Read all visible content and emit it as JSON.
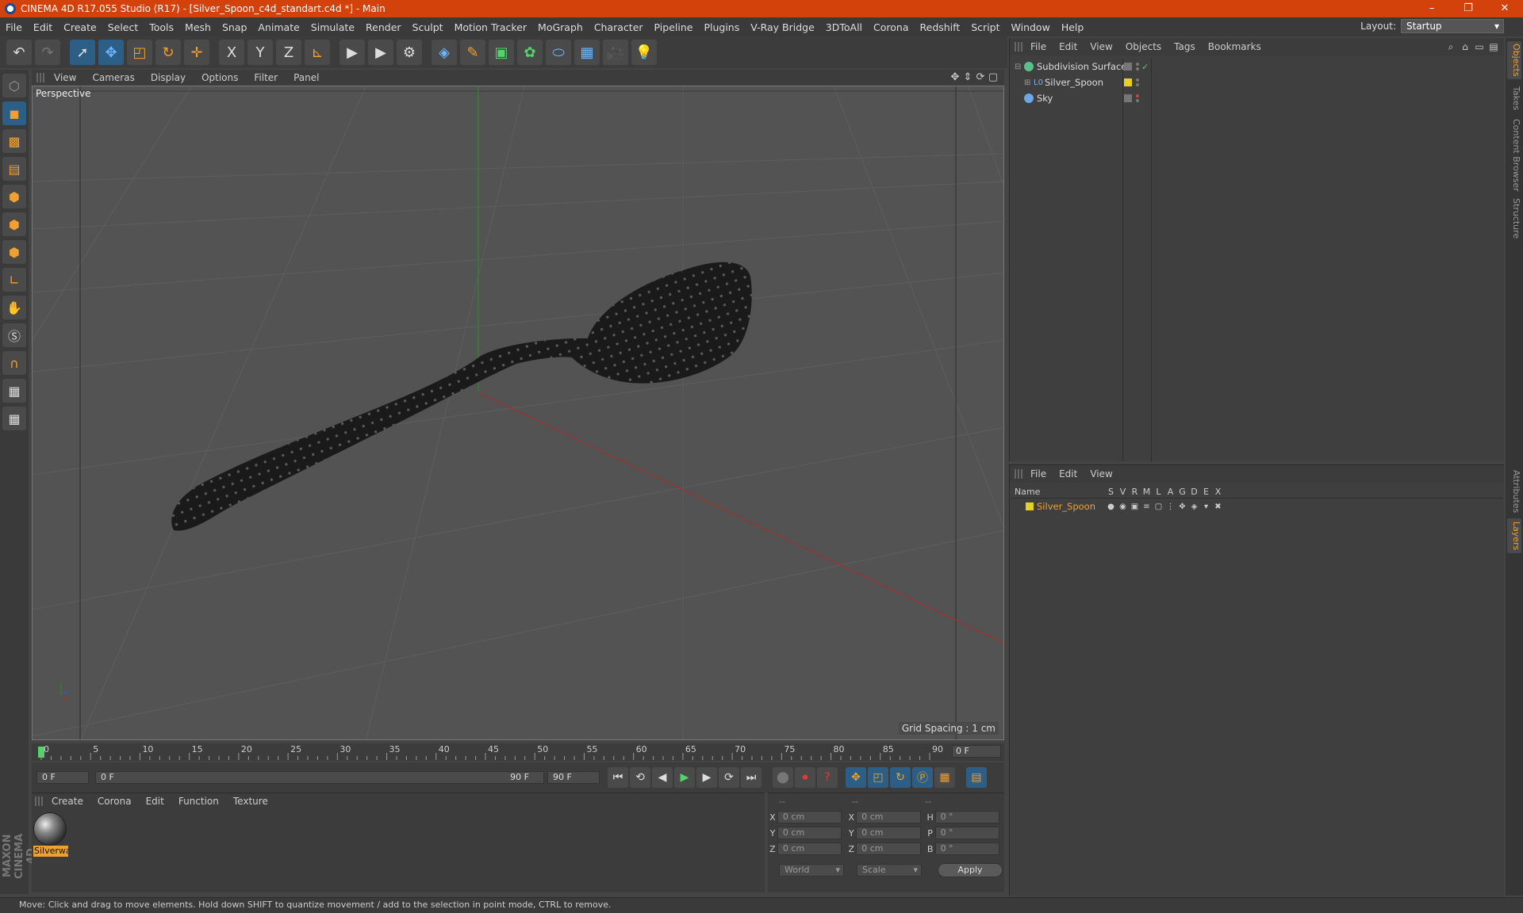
{
  "window": {
    "title": "CINEMA 4D R17.055 Studio (R17) - [Silver_Spoon_c4d_standart.c4d *] - Main",
    "controls": [
      "–",
      "❐",
      "✕"
    ]
  },
  "menubar": {
    "items": [
      "File",
      "Edit",
      "Create",
      "Select",
      "Tools",
      "Mesh",
      "Snap",
      "Animate",
      "Simulate",
      "Render",
      "Sculpt",
      "Motion Tracker",
      "MoGraph",
      "Character",
      "Pipeline",
      "Plugins",
      "V-Ray Bridge",
      "3DToAll",
      "Corona",
      "Redshift",
      "Script",
      "Window",
      "Help"
    ],
    "layout_label": "Layout:",
    "layout_value": "Startup"
  },
  "toolbar": {
    "icons": [
      "undo-icon",
      "redo-icon",
      "select-arrow-icon",
      "move-icon",
      "scale-icon",
      "rotate-icon",
      "add-tool-icon",
      "x-axis-icon",
      "y-axis-icon",
      "z-axis-icon",
      "coordinate-system-icon",
      "render-view-icon",
      "render-picture-viewer-icon",
      "edit-render-settings-icon",
      "cube-icon",
      "pen-icon",
      "subdivision-icon",
      "array-icon",
      "deformer-icon",
      "floor-icon",
      "camera-icon",
      "light-icon"
    ],
    "axis_labels": [
      "X",
      "Y",
      "Z"
    ]
  },
  "viewport": {
    "menu": [
      "View",
      "Cameras",
      "Display",
      "Options",
      "Filter",
      "Panel"
    ],
    "label": "Perspective",
    "grid_spacing": "Grid Spacing : 1 cm"
  },
  "timeline": {
    "ticks": [
      "0",
      "5",
      "10",
      "15",
      "20",
      "25",
      "30",
      "35",
      "40",
      "45",
      "50",
      "55",
      "60",
      "65",
      "70",
      "75",
      "80",
      "85",
      "90"
    ],
    "current_frame": "0 F",
    "start_field": "0 F",
    "range_start": "0 F",
    "range_end": "90 F",
    "end_field": "90 F"
  },
  "material_manager": {
    "menu": [
      "Create",
      "Corona",
      "Edit",
      "Function",
      "Texture"
    ],
    "materials": [
      {
        "name": "Silverwa"
      }
    ]
  },
  "coordinates": {
    "headers": [
      "--",
      "--",
      "--"
    ],
    "rows": [
      {
        "a1": "X",
        "v1": "0 cm",
        "a2": "X",
        "v2": "0 cm",
        "a3": "H",
        "v3": "0 °"
      },
      {
        "a1": "Y",
        "v1": "0 cm",
        "a2": "Y",
        "v2": "0 cm",
        "a3": "P",
        "v3": "0 °"
      },
      {
        "a1": "Z",
        "v1": "0 cm",
        "a2": "Z",
        "v2": "0 cm",
        "a3": "B",
        "v3": "0 °"
      }
    ],
    "mode1": "World",
    "mode2": "Scale",
    "apply": "Apply"
  },
  "object_manager": {
    "menu": [
      "File",
      "Edit",
      "View",
      "Objects",
      "Tags",
      "Bookmarks"
    ],
    "objects": [
      {
        "name": "Subdivision Surface",
        "color": "#59c28a"
      },
      {
        "name": "Silver_Spoon",
        "color": "#7fb0e0"
      },
      {
        "name": "Sky",
        "color": "#6ea6e8"
      }
    ]
  },
  "layer_manager": {
    "menu": [
      "File",
      "Edit",
      "View"
    ],
    "columns": [
      "Name",
      "S",
      "V",
      "R",
      "M",
      "L",
      "A",
      "G",
      "D",
      "E",
      "X"
    ],
    "layers": [
      {
        "name": "Silver_Spoon",
        "color": "#e8d020"
      }
    ]
  },
  "side_tabs": [
    "Objects",
    "Takes",
    "Content Browser",
    "Structure",
    "Attributes",
    "Layers"
  ],
  "status": "Move: Click and drag to move elements. Hold down SHIFT to quantize movement / add to the selection in point mode, CTRL to remove.",
  "maxon_logo": "MAXON CINEMA 4D",
  "colors": {
    "accent": "#f0a030",
    "titlebar": "#d3420b",
    "selected_tool": "#2d5f86"
  }
}
